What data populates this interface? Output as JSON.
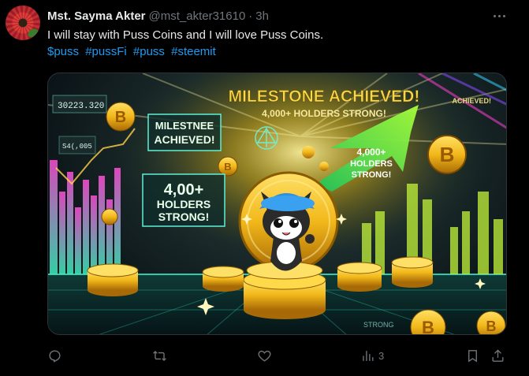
{
  "author": {
    "display_name": "Mst. Sayma Akter",
    "handle": "@mst_akter31610",
    "separator": "·",
    "time": "3h"
  },
  "tweet": {
    "text": "I will stay with Puss Coins and I will love Puss Coins.",
    "hashtags": [
      "$puss",
      "#pussFi",
      "#puss",
      "#steemit"
    ]
  },
  "media": {
    "headline_1": "MILESTONE ACHIEVED!",
    "headline_2": "4,000+ HOLDERS STRONG!",
    "screen_top_left": "30223.320",
    "screen_small": "S4(,005",
    "panel_milestone_1": "MILESTNEE",
    "panel_milestone_2": "ACHIEVED!",
    "panel_holders_1": "4,00+",
    "panel_holders_2": "HOLDERS",
    "panel_holders_3": "STRONG!",
    "arrow_line_1": "4,000+",
    "arrow_line_2": "HOLDERS",
    "arrow_line_3": "STRONG!",
    "corner_achieved": "ACHIEVED!",
    "floor_text": "STRONG",
    "coin_symbol": "B",
    "colors": {
      "gold": "#f2c12e",
      "green": "#46f26a",
      "cyan": "#39e6d6"
    }
  },
  "actions": {
    "reply_icon": "reply-icon",
    "retweet_icon": "retweet-icon",
    "like_icon": "heart-icon",
    "views_icon": "analytics-icon",
    "views_count": "3",
    "bookmark_icon": "bookmark-icon",
    "share_icon": "share-icon"
  }
}
